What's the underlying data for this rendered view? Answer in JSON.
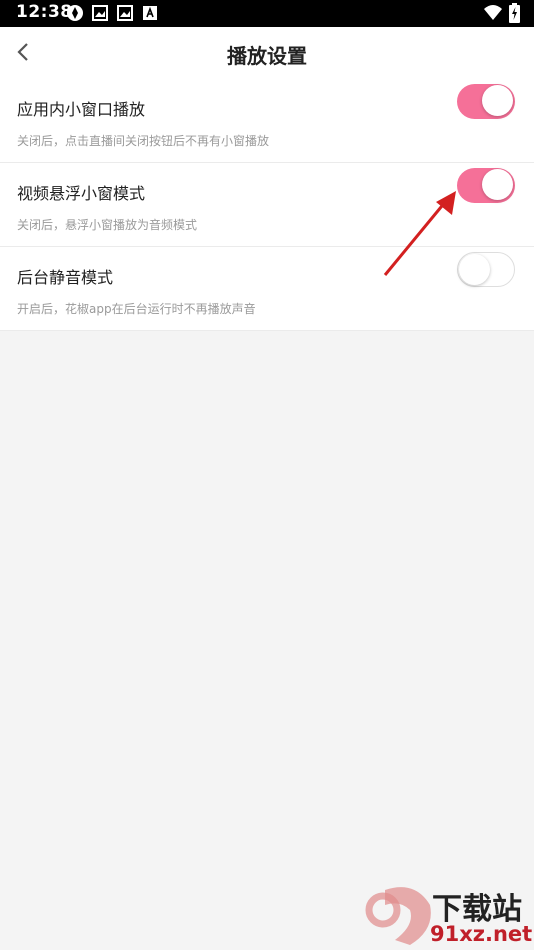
{
  "status_bar": {
    "time": "12:38",
    "icons": [
      "sync-icon",
      "image-icon",
      "image-icon",
      "a-icon"
    ],
    "right_icons": [
      "wifi-icon",
      "battery-charging-icon"
    ]
  },
  "header": {
    "title": "播放设置",
    "back_icon": "chevron-left-icon"
  },
  "settings": [
    {
      "label": "应用内小窗口播放",
      "desc": "关闭后，点击直播间关闭按钮后不再有小窗播放",
      "enabled": true
    },
    {
      "label": "视频悬浮小窗模式",
      "desc": "关闭后，悬浮小窗播放为音频模式",
      "enabled": true
    },
    {
      "label": "后台静音模式",
      "desc": "开启后，花椒app在后台运行时不再播放声音",
      "enabled": false
    }
  ],
  "colors": {
    "toggle_on": "#f57098",
    "annotation_arrow": "#d32020"
  },
  "watermark": {
    "line1": "下载站",
    "line2": "91xz.net"
  }
}
